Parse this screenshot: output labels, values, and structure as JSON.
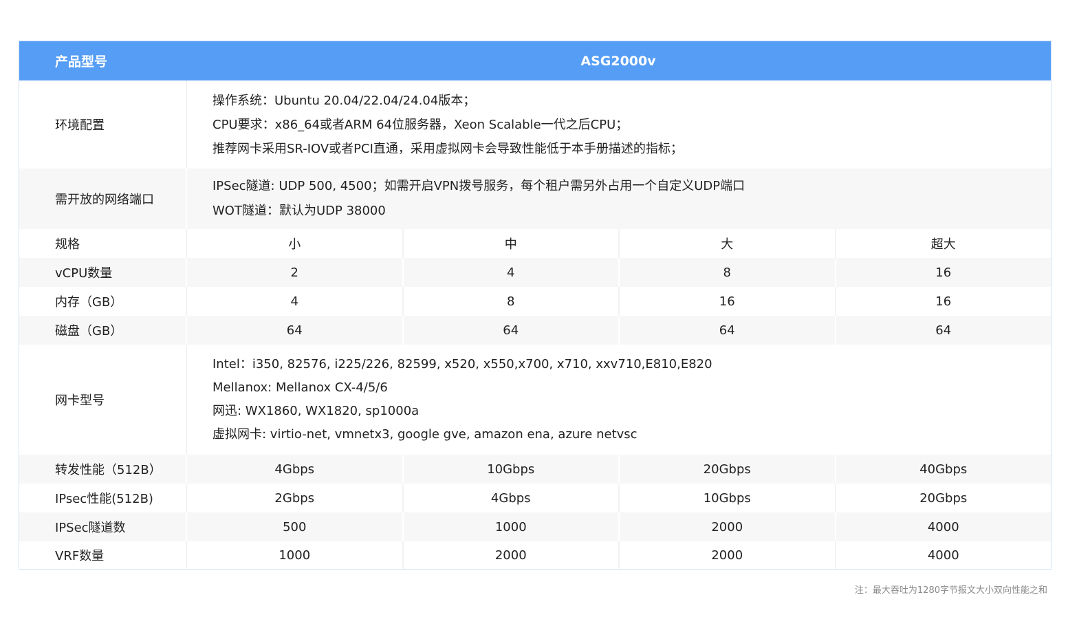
{
  "header": {
    "label": "产品型号",
    "model": "ASG2000v"
  },
  "env": {
    "label": "环境配置",
    "lines": [
      "操作系统：Ubuntu 20.04/22.04/24.04版本；",
      "CPU要求：x86_64或者ARM 64位服务器，Xeon Scalable一代之后CPU；",
      "推荐网卡采用SR-IOV或者PCI直通，采用虚拟网卡会导致性能低于本手册描述的指标；"
    ]
  },
  "ports": {
    "label": "需开放的网络端口",
    "lines": [
      "IPSec隧道: UDP 500, 4500；如需开启VPN拨号服务，每个租户需另外占用一个自定义UDP端口",
      "WOT隧道：默认为UDP 38000"
    ]
  },
  "spec": {
    "label": "规格",
    "values": [
      "小",
      "中",
      "大",
      "超大"
    ]
  },
  "vcpu": {
    "label": "vCPU数量",
    "values": [
      "2",
      "4",
      "8",
      "16"
    ]
  },
  "mem": {
    "label": "内存（GB）",
    "values": [
      "4",
      "8",
      "16",
      "16"
    ]
  },
  "disk": {
    "label": "磁盘（GB）",
    "values": [
      "64",
      "64",
      "64",
      "64"
    ]
  },
  "nic": {
    "label": "网卡型号",
    "lines": [
      "Intel：i350, 82576, i225/226, 82599, x520, x550,x700, x710, xxv710,E810,E820",
      "Mellanox: Mellanox CX-4/5/6",
      "网迅: WX1860, WX1820, sp1000a",
      "虚拟网卡: virtio-net, vmnetx3, google gve, amazon ena, azure netvsc"
    ]
  },
  "fwd": {
    "label": "转发性能（512B）",
    "values": [
      "4Gbps",
      "10Gbps",
      "20Gbps",
      "40Gbps"
    ]
  },
  "ipsec": {
    "label": "IPsec性能(512B)",
    "values": [
      "2Gbps",
      "4Gbps",
      "10Gbps",
      "20Gbps"
    ]
  },
  "tunnels": {
    "label": "IPSec隧道数",
    "values": [
      "500",
      "1000",
      "2000",
      "4000"
    ]
  },
  "vrf": {
    "label": "VRF数量",
    "values": [
      "1000",
      "2000",
      "2000",
      "4000"
    ]
  },
  "note": "注：最大吞吐为1280字节报文大小双向性能之和"
}
